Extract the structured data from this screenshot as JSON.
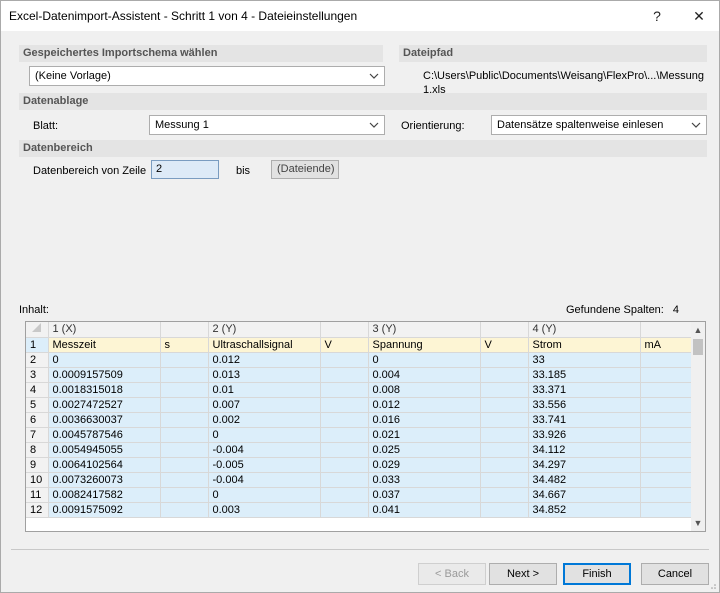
{
  "window": {
    "title": "Excel-Datenimport-Assistent - Schritt 1 von 4 - Dateieinstellungen",
    "help_label": "?",
    "close_label": "✕"
  },
  "import_schema": {
    "header": "Gespeichertes Importschema wählen",
    "selected": "(Keine Vorlage)"
  },
  "file_path": {
    "header": "Dateipfad",
    "value": "C:\\Users\\Public\\Documents\\Weisang\\FlexPro\\...\\Messung 1.xls"
  },
  "storage": {
    "header": "Datenablage",
    "sheet_label": "Blatt:",
    "sheet_value": "Messung 1",
    "orientation_label": "Orientierung:",
    "orientation_value": "Datensätze spaltenweise einlesen"
  },
  "range": {
    "header": "Datenbereich",
    "from_label": "Datenbereich von Zeile",
    "from_value": "2",
    "to_label": "bis",
    "to_value": "(Dateiende)"
  },
  "content": {
    "label": "Inhalt:",
    "found_label": "Gefundene Spalten:",
    "found_count": "4"
  },
  "grid": {
    "columns": [
      "1 (X)",
      "",
      "2 (Y)",
      "",
      "3 (Y)",
      "",
      "4 (Y)",
      ""
    ],
    "header_row": [
      "1",
      "Messzeit",
      "s",
      "Ultraschallsignal",
      "V",
      "Spannung",
      "V",
      "Strom",
      "mA"
    ],
    "rows": [
      [
        "2",
        "0",
        "",
        "0.012",
        "",
        "0",
        "",
        "33",
        ""
      ],
      [
        "3",
        "0.0009157509",
        "",
        "0.013",
        "",
        "0.004",
        "",
        "33.185",
        ""
      ],
      [
        "4",
        "0.0018315018",
        "",
        "0.01",
        "",
        "0.008",
        "",
        "33.371",
        ""
      ],
      [
        "5",
        "0.0027472527",
        "",
        "0.007",
        "",
        "0.012",
        "",
        "33.556",
        ""
      ],
      [
        "6",
        "0.0036630037",
        "",
        "0.002",
        "",
        "0.016",
        "",
        "33.741",
        ""
      ],
      [
        "7",
        "0.0045787546",
        "",
        "0",
        "",
        "0.021",
        "",
        "33.926",
        ""
      ],
      [
        "8",
        "0.0054945055",
        "",
        "-0.004",
        "",
        "0.025",
        "",
        "34.112",
        ""
      ],
      [
        "9",
        "0.0064102564",
        "",
        "-0.005",
        "",
        "0.029",
        "",
        "34.297",
        ""
      ],
      [
        "10",
        "0.0073260073",
        "",
        "-0.004",
        "",
        "0.033",
        "",
        "34.482",
        ""
      ],
      [
        "11",
        "0.0082417582",
        "",
        "0",
        "",
        "0.037",
        "",
        "34.667",
        ""
      ],
      [
        "12",
        "0.0091575092",
        "",
        "0.003",
        "",
        "0.041",
        "",
        "34.852",
        ""
      ]
    ]
  },
  "buttons": {
    "back": "< Back",
    "next": "Next >",
    "finish": "Finish",
    "cancel": "Cancel"
  },
  "icons": {
    "combo_arrow": "chevron-down-icon",
    "scroll_up": "chevron-up-icon",
    "scroll_down": "chevron-down-icon"
  },
  "colors": {
    "unit_row": "#fdf5d4",
    "data_cells": "#dceefa",
    "default_button_border": "#0078d7"
  }
}
